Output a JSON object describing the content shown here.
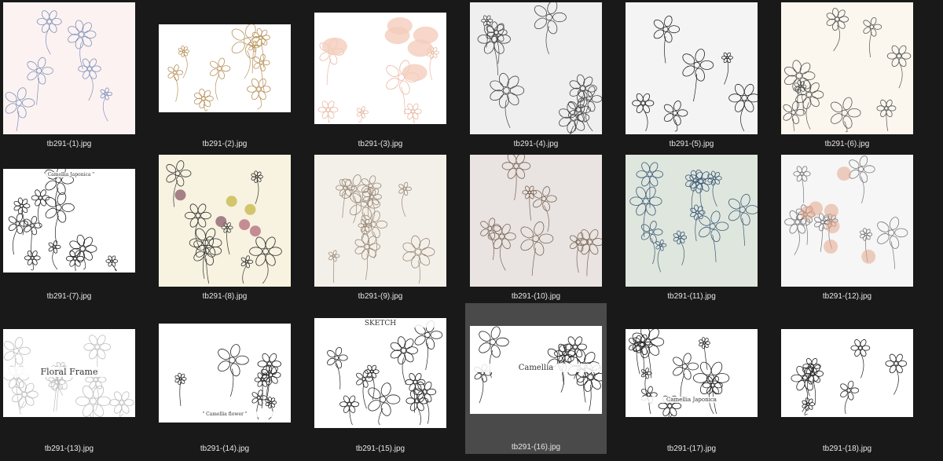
{
  "files": [
    {
      "name": "tb291-(1).jpg",
      "bg": "#fcf2f2",
      "style": "blue-sketch"
    },
    {
      "name": "tb291-(2).jpg",
      "bg": "#ffffff",
      "style": "gold-bouquet"
    },
    {
      "name": "tb291-(3).jpg",
      "bg": "#ffffff",
      "style": "peach-poppies"
    },
    {
      "name": "tb291-(4).jpg",
      "bg": "#efefef",
      "style": "botanical-set"
    },
    {
      "name": "tb291-(5).jpg",
      "bg": "#f4f4f4",
      "style": "ink-flowers"
    },
    {
      "name": "tb291-(6).jpg",
      "bg": "#fbf7ee",
      "style": "wildflowers"
    },
    {
      "name": "tb291-(7).jpg",
      "bg": "#ffffff",
      "style": "camellia-japonica",
      "label": "\" Camellia Japonica \""
    },
    {
      "name": "tb291-(8).jpg",
      "bg": "#f7f3e0",
      "style": "colored-doodles"
    },
    {
      "name": "tb291-(9).jpg",
      "bg": "#f3f0ea",
      "style": "minimal-sprigs"
    },
    {
      "name": "tb291-(10).jpg",
      "bg": "#e9e4e2",
      "style": "brown-botanicals"
    },
    {
      "name": "tb291-(11).jpg",
      "bg": "#dfe6dd",
      "style": "blue-line-flowers"
    },
    {
      "name": "tb291-(12).jpg",
      "bg": "#f6f6f6",
      "style": "watercolor-accents"
    },
    {
      "name": "tb291-(13).jpg",
      "bg": "#ffffff",
      "style": "floral-frame",
      "label": "Floral Frame"
    },
    {
      "name": "tb291-(14).jpg",
      "bg": "#ffffff",
      "style": "camellia-flower",
      "label": "\" Camellia flower \""
    },
    {
      "name": "tb291-(15).jpg",
      "bg": "#ffffff",
      "style": "sketch-set",
      "label": "SKETCH"
    },
    {
      "name": "tb291-(16).jpg",
      "bg": "#ffffff",
      "style": "camellia-flowers-leaves",
      "label": "Camellia",
      "selected": true
    },
    {
      "name": "tb291-(17).jpg",
      "bg": "#ffffff",
      "style": "camellia-japonica-2",
      "label": "Camellia Japonica"
    },
    {
      "name": "tb291-(18).jpg",
      "bg": "#ffffff",
      "style": "clematis"
    }
  ],
  "colors": {
    "background": "#191919",
    "caption": "#e6e6e6",
    "selection": "#4a4a4a"
  }
}
